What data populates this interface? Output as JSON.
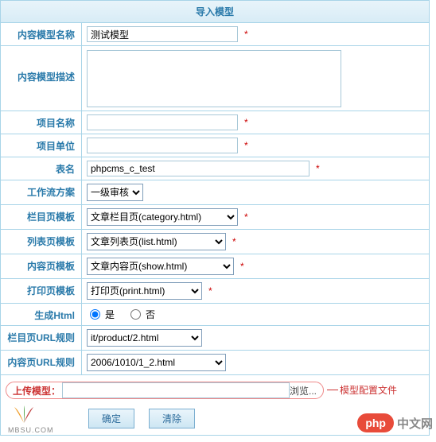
{
  "header": {
    "title": "导入模型"
  },
  "fields": {
    "modelName": {
      "label": "内容模型名称",
      "value": "测试模型"
    },
    "modelDesc": {
      "label": "内容模型描述",
      "value": ""
    },
    "projectName": {
      "label": "项目名称",
      "value": ""
    },
    "projectUnit": {
      "label": "项目单位",
      "value": ""
    },
    "tableName": {
      "label": "表名",
      "value": "phpcms_c_test"
    },
    "workflow": {
      "label": "工作流方案",
      "selected": "一级审核"
    },
    "categoryTpl": {
      "label": "栏目页模板",
      "selected": "文章栏目页(category.html)"
    },
    "listTpl": {
      "label": "列表页模板",
      "selected": "文章列表页(list.html)"
    },
    "contentTpl": {
      "label": "内容页模板",
      "selected": "文章内容页(show.html)"
    },
    "printTpl": {
      "label": "打印页模板",
      "selected": "打印页(print.html)"
    },
    "genHtml": {
      "label": "生成Html",
      "yes": "是",
      "no": "否",
      "value": "yes"
    },
    "categoryUrl": {
      "label": "栏目页URL规则",
      "selected": "it/product/2.html"
    },
    "contentUrl": {
      "label": "内容页URL规则",
      "selected": "2006/1010/1_2.html"
    }
  },
  "upload": {
    "label": "上传模型：",
    "browse": "浏览...",
    "note": "模型配置文件"
  },
  "buttons": {
    "submit": "确定",
    "reset": "清除"
  },
  "footer": {
    "logo_text": "MBSU.COM",
    "badge": "php",
    "badge_cn": "中文网"
  },
  "star": "*"
}
